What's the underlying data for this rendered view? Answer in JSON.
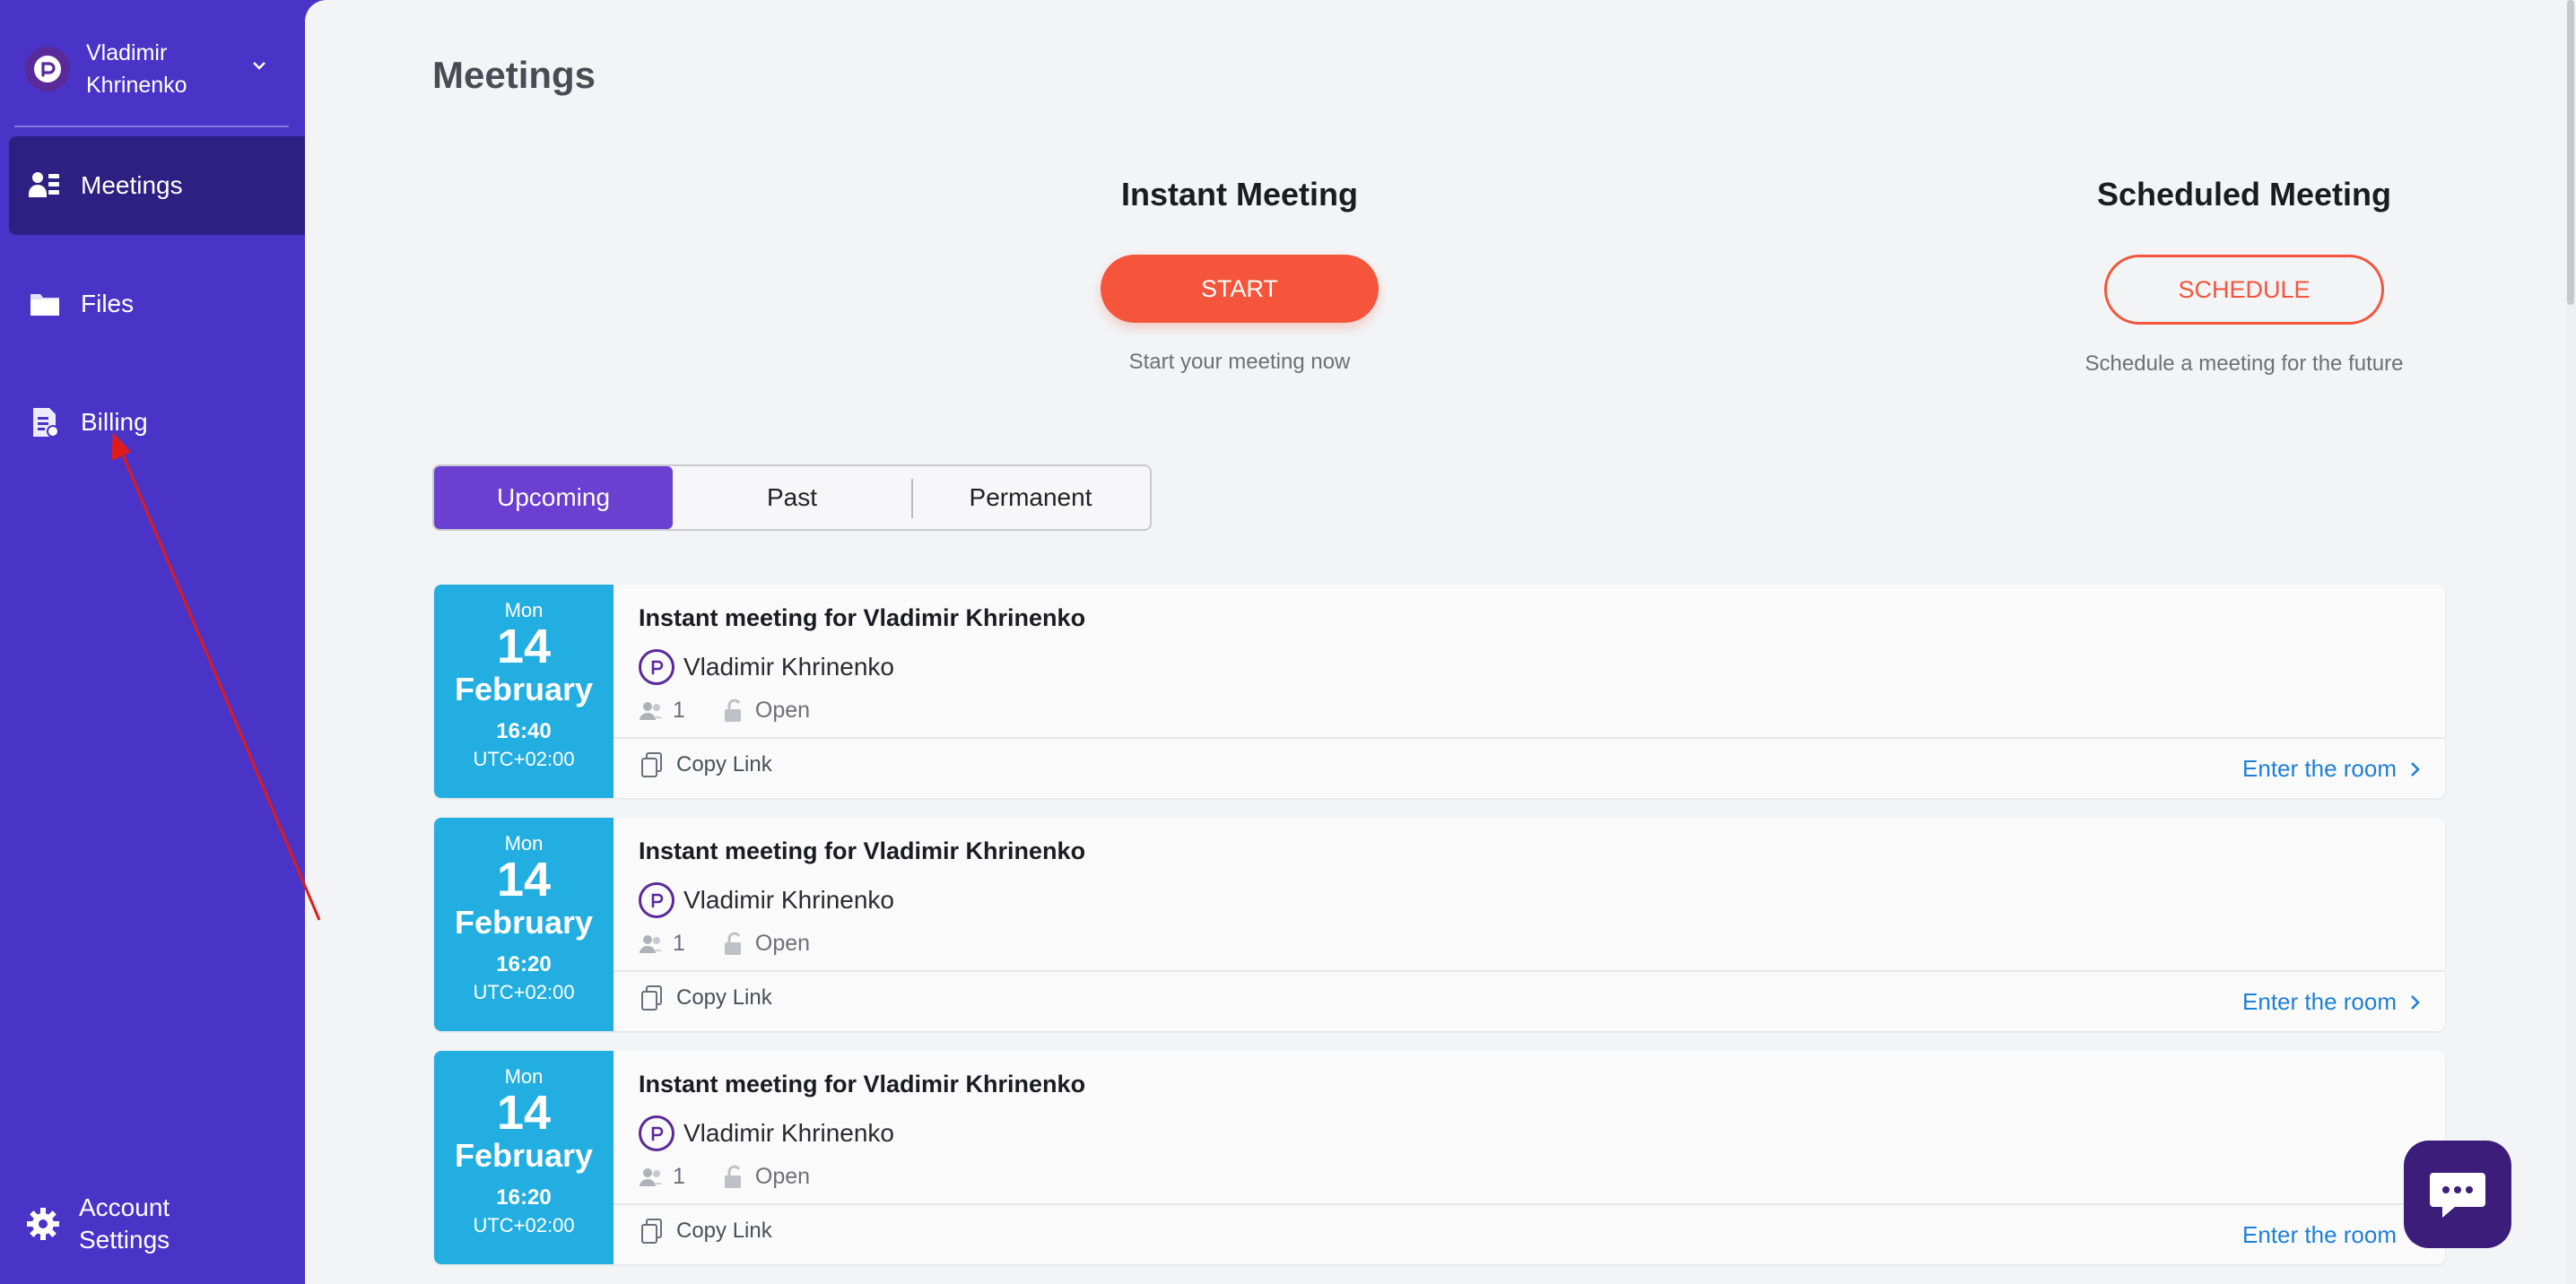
{
  "user": {
    "name": "Vladimir Khrinenko"
  },
  "sidebar": {
    "items": [
      {
        "label": "Meetings",
        "icon": "users-icon",
        "active": true
      },
      {
        "label": "Files",
        "icon": "folder-icon",
        "active": false
      },
      {
        "label": "Billing",
        "icon": "billing-icon",
        "active": false
      }
    ],
    "account_settings": "Account Settings"
  },
  "main": {
    "title": "Meetings",
    "instant": {
      "title": "Instant Meeting",
      "button": "START",
      "subtitle": "Start your meeting now"
    },
    "scheduled": {
      "title": "Scheduled Meeting",
      "button": "SCHEDULE",
      "subtitle": "Schedule a meeting for the future"
    },
    "tabs": [
      "Upcoming",
      "Past",
      "Permanent"
    ],
    "meetings": [
      {
        "dow": "Mon",
        "day": "14",
        "month": "February",
        "time": "16:40",
        "tz": "UTC+02:00",
        "title": "Instant meeting for Vladimir Khrinenko",
        "host": "Vladimir Khrinenko",
        "participants": "1",
        "access": "Open",
        "copy": "Copy Link",
        "enter": "Enter the room"
      },
      {
        "dow": "Mon",
        "day": "14",
        "month": "February",
        "time": "16:20",
        "tz": "UTC+02:00",
        "title": "Instant meeting for Vladimir Khrinenko",
        "host": "Vladimir Khrinenko",
        "participants": "1",
        "access": "Open",
        "copy": "Copy Link",
        "enter": "Enter the room"
      },
      {
        "dow": "Mon",
        "day": "14",
        "month": "February",
        "time": "16:20",
        "tz": "UTC+02:00",
        "title": "Instant meeting for Vladimir Khrinenko",
        "host": "Vladimir Khrinenko",
        "participants": "1",
        "access": "Open",
        "copy": "Copy Link",
        "enter": "Enter the room"
      }
    ]
  },
  "colors": {
    "sidebar": "#4a33c7",
    "accent": "#f4553b",
    "tab_active": "#6b3fd0",
    "date_block": "#22aee0",
    "link": "#1e7fd6"
  }
}
